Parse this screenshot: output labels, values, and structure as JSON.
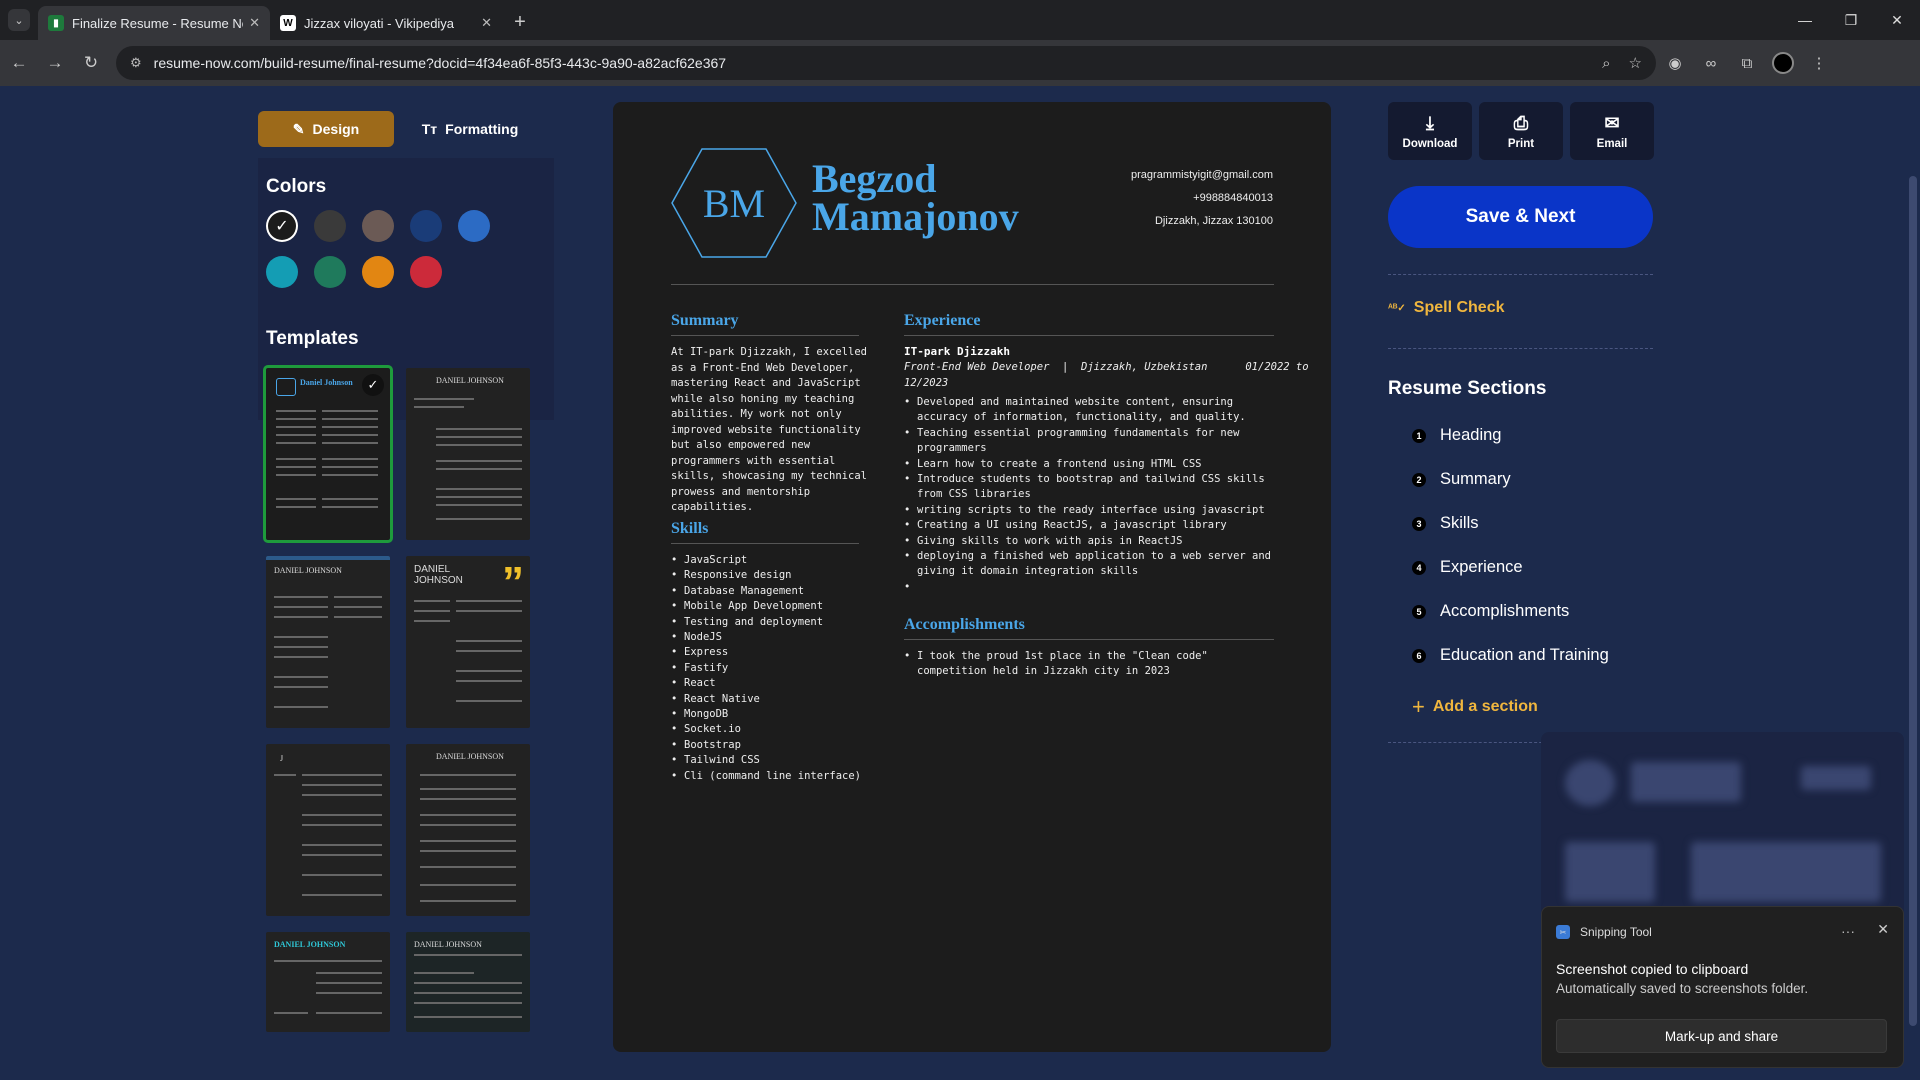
{
  "browser": {
    "tabs": [
      {
        "title": "Finalize Resume - Resume Now",
        "active": true
      },
      {
        "title": "Jizzax viloyati - Vikipediya",
        "active": false
      }
    ],
    "url": "resume-now.com/build-resume/final-resume?docid=4f34ea6f-85f3-443c-9a90-a82acf62e367"
  },
  "sidebar": {
    "tab_design": "Design",
    "tab_formatting": "Formatting",
    "colors_heading": "Colors",
    "colors": [
      "#1c1c1c",
      "#3a3a3a",
      "#6b5a55",
      "#1a3c78",
      "#2c6bc4",
      "#149db4",
      "#1f7a5c",
      "#e28612",
      "#cc2a3a"
    ],
    "selected_color_index": 0,
    "templates_heading": "Templates",
    "templates": [
      {
        "name": "Daniel Johnson",
        "selected": true
      },
      {
        "name": "DANIEL JOHNSON",
        "selected": false
      },
      {
        "name": "DANIEL JOHNSON",
        "selected": false
      },
      {
        "name": "DANIEL JOHNSON",
        "selected": false
      },
      {
        "name": "J",
        "selected": false
      },
      {
        "name": "DANIEL JOHNSON",
        "selected": false
      },
      {
        "name": "DANIEL JOHNSON",
        "selected": false
      },
      {
        "name": "DANIEL JOHNSON",
        "selected": false
      }
    ]
  },
  "resume": {
    "initials": "BM",
    "first_name": "Begzod",
    "last_name": "Mamajonov",
    "email": "pragrammistyigit@gmail.com",
    "phone": "+998884840013",
    "location": "Djizzakh, Jizzax 130100",
    "summary_title": "Summary",
    "summary": "At IT-park Djizzakh, I excelled as a Front-End Web Developer, mastering React and JavaScript while also honing my teaching abilities. My work not only improved website functionality but also empowered new programmers with essential skills, showcasing my technical prowess and mentorship capabilities.",
    "skills_title": "Skills",
    "skills": [
      "JavaScript",
      "Responsive design",
      "Database Management",
      "Mobile App Development",
      "Testing and deployment",
      "NodeJS",
      "Express",
      "Fastify",
      "React",
      "React Native",
      "MongoDB",
      "Socket.io",
      "Bootstrap",
      "Tailwind CSS",
      "Cli (command line interface)"
    ],
    "experience_title": "Experience",
    "company": "IT-park Djizzakh",
    "role_line": "Front-End Web Developer  |  Djizzakh, Uzbekistan      01/2022 to",
    "role_line2": "12/2023",
    "experience": [
      "Developed and maintained website content, ensuring accuracy of information, functionality, and quality.",
      "Teaching essential programming fundamentals for new programmers",
      "Learn how to create a frontend using HTML CSS",
      "Introduce students to bootstrap and tailwind CSS skills from CSS libraries",
      "writing scripts to the ready interface using javascript",
      "Creating a UI using ReactJS, a javascript library",
      "Giving skills to work with apis in ReactJS",
      "deploying a finished web application to a web server and giving it domain integration skills",
      ""
    ],
    "accomplishments_title": "Accomplishments",
    "accomplishments": [
      "I took the proud 1st place in the \"Clean code\" competition held in Jizzakh city in 2023"
    ]
  },
  "actions": {
    "download": "Download",
    "print": "Print",
    "email": "Email",
    "save_next": "Save & Next",
    "spell_check": "Spell Check"
  },
  "sections": {
    "heading": "Resume Sections",
    "items": [
      {
        "num": "1",
        "label": "Heading"
      },
      {
        "num": "2",
        "label": "Summary"
      },
      {
        "num": "3",
        "label": "Skills"
      },
      {
        "num": "4",
        "label": "Experience"
      },
      {
        "num": "5",
        "label": "Accomplishments"
      },
      {
        "num": "6",
        "label": "Education and Training"
      }
    ],
    "add_section": "Add a section"
  },
  "toast": {
    "app": "Snipping Tool",
    "title": "Screenshot copied to clipboard",
    "body": "Automatically saved to screenshots folder.",
    "button": "Mark-up and share"
  }
}
